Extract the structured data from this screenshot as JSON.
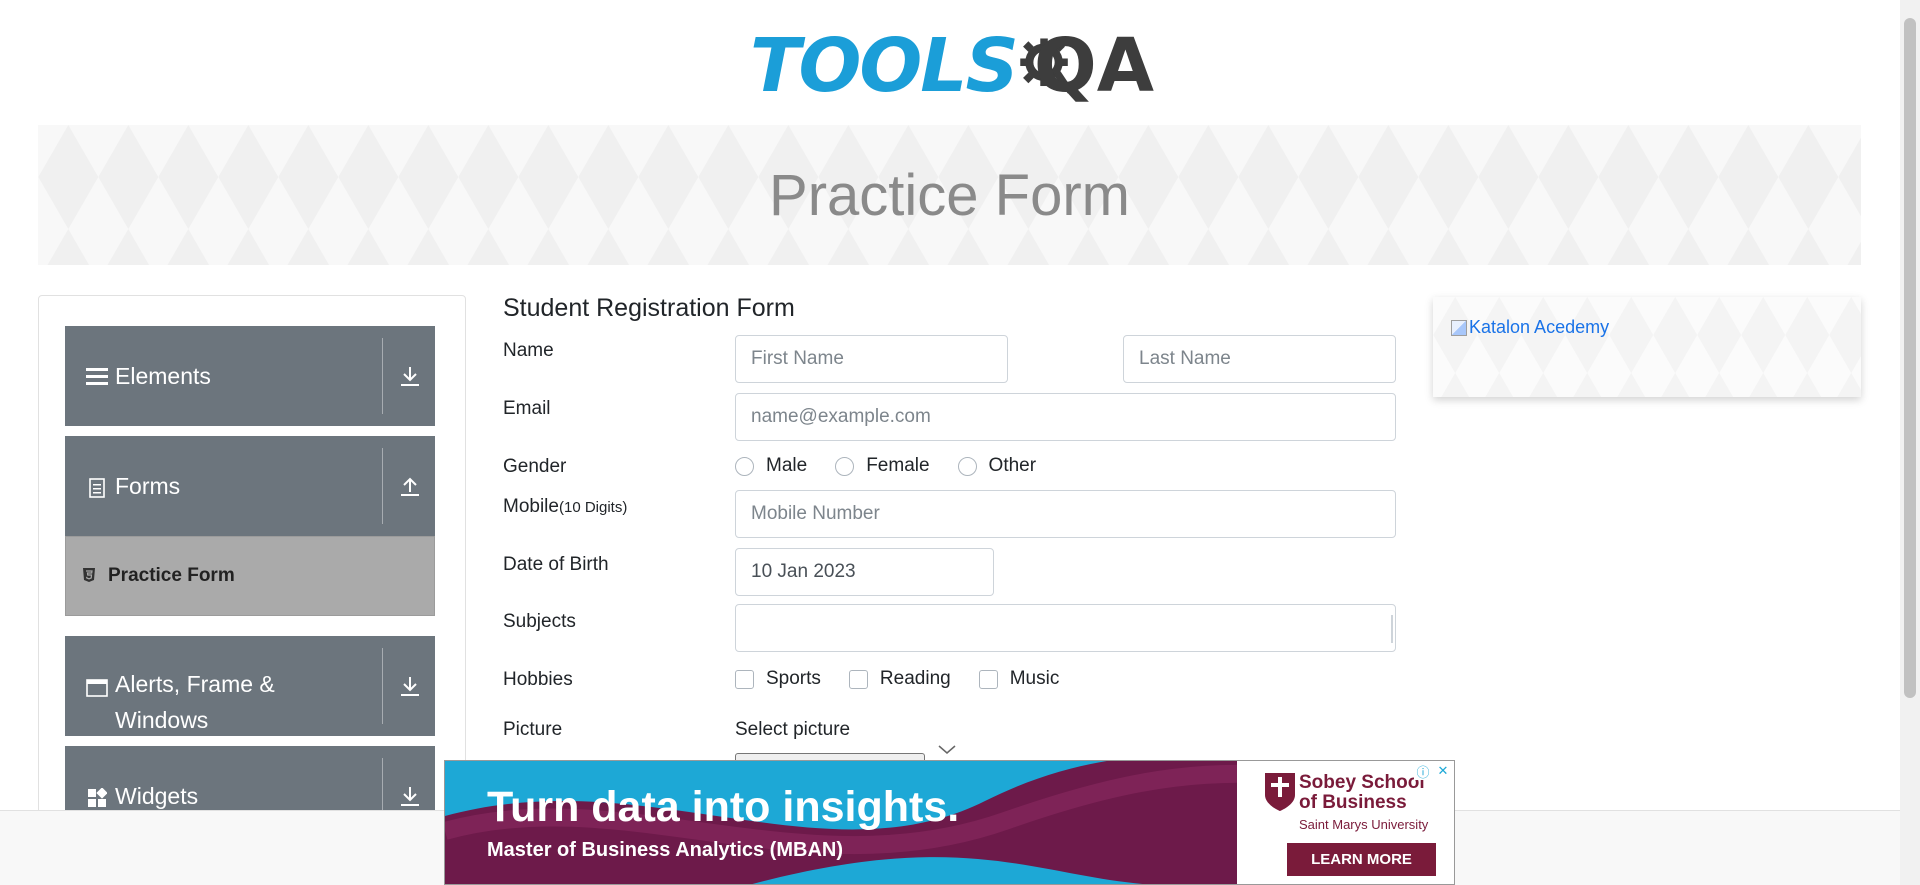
{
  "logo": {
    "text_tools": "TOOLS",
    "text_qa": "QA"
  },
  "banner": {
    "title": "Practice Form"
  },
  "sidebar": {
    "groups": [
      {
        "label": "Elements",
        "icon": "list-icon",
        "arrow": "download-arrow-icon"
      },
      {
        "label": "Forms",
        "icon": "document-icon",
        "arrow": "upload-arrow-icon"
      },
      {
        "label_line1": "Alerts, Frame &",
        "label_line2": "Windows",
        "icon": "window-icon",
        "arrow": "download-arrow-icon"
      },
      {
        "label": "Widgets",
        "icon": "widgets-icon",
        "arrow": "download-arrow-icon"
      }
    ],
    "active_item": {
      "label": "Practice Form",
      "icon": "html5-icon"
    }
  },
  "form": {
    "title": "Student Registration Form",
    "name_label": "Name",
    "first_name_placeholder": "First Name",
    "last_name_placeholder": "Last Name",
    "email_label": "Email",
    "email_placeholder": "name@example.com",
    "gender_label": "Gender",
    "genders": [
      "Male",
      "Female",
      "Other"
    ],
    "mobile_label": "Mobile",
    "mobile_hint": "(10 Digits)",
    "mobile_placeholder": "Mobile Number",
    "dob_label": "Date of Birth",
    "dob_value": "10 Jan 2023",
    "subjects_label": "Subjects",
    "subjects_value": "",
    "hobbies_label": "Hobbies",
    "hobbies": [
      "Sports",
      "Reading",
      "Music"
    ],
    "picture_label": "Picture",
    "picture_select_label": "Select picture"
  },
  "side_ad": {
    "alt_text": "Katalon Acedemy"
  },
  "bottom_ad": {
    "headline": "Turn data into insights.",
    "subline": "Master of Business Analytics (MBAN)",
    "school_name_line1": "Sobey School",
    "school_name_line2": "of Business",
    "university": "Saint Marys University",
    "cta": "LEARN MORE"
  },
  "colors": {
    "logo_blue": "#1b9ed8",
    "logo_dark": "#3d3d3d",
    "sidebar_group": "#6c757d",
    "sidebar_active": "#aaaaaa",
    "ad_blue": "#1da8d6",
    "ad_maroon": "#7a1b3a"
  }
}
